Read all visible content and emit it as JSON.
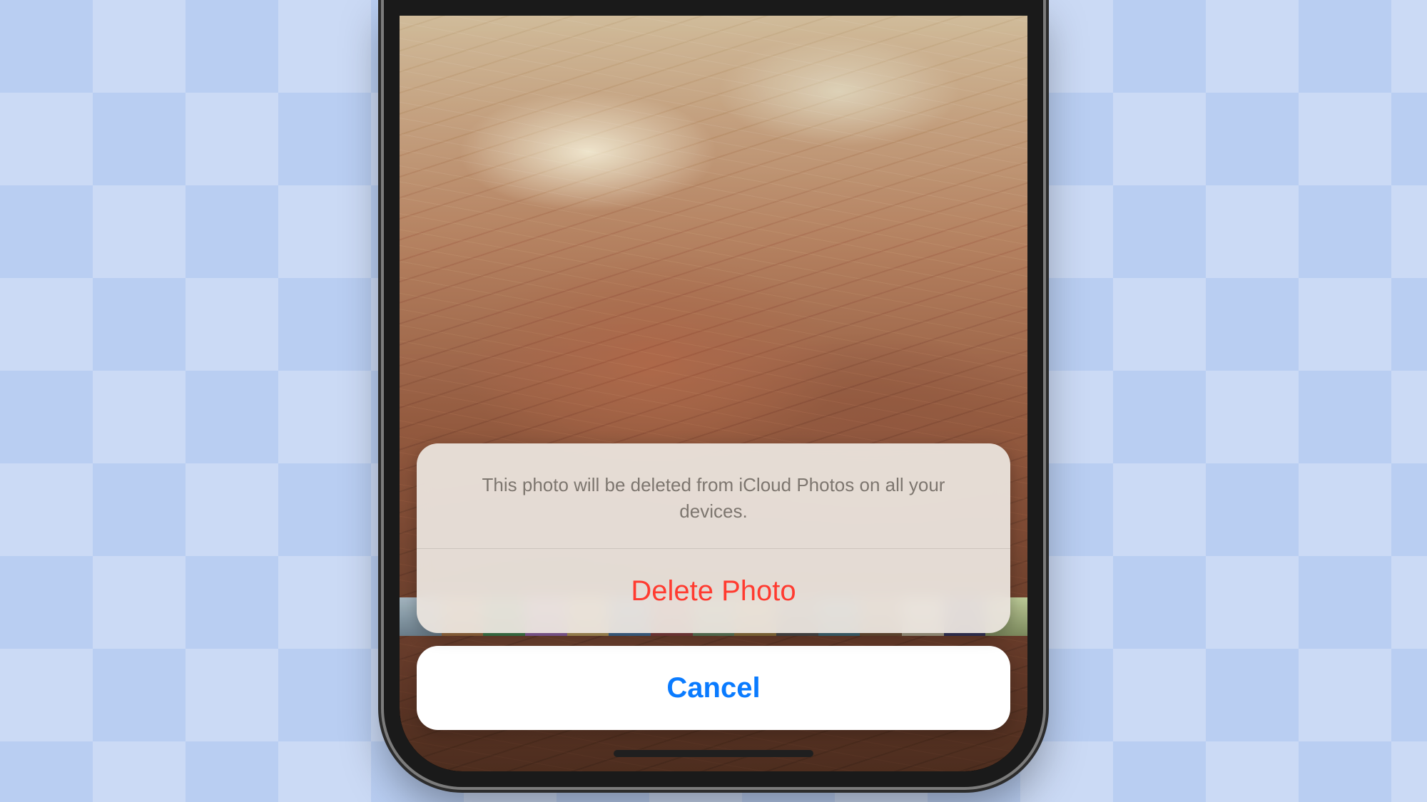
{
  "action_sheet": {
    "message": "This photo will be deleted from iCloud Photos on all your devices.",
    "destructive_label": "Delete Photo",
    "cancel_label": "Cancel"
  },
  "colors": {
    "destructive": "#ff3b30",
    "accent": "#0a7bff"
  }
}
